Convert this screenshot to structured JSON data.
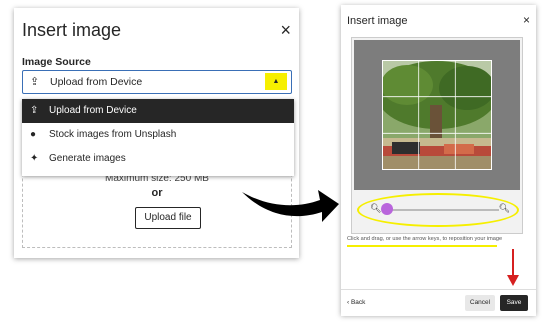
{
  "left_dialog": {
    "title": "Insert image",
    "close_icon": "×",
    "source_label": "Image Source",
    "selected": "Upload from Device",
    "menu_items": [
      {
        "icon": "upload-icon",
        "glyph": "⇪",
        "label": "Upload from Device"
      },
      {
        "icon": "globe-icon",
        "glyph": "●",
        "label": "Stock images from Unsplash"
      },
      {
        "icon": "sparkle-icon",
        "glyph": "✦",
        "label": "Generate images"
      }
    ],
    "max_size_text": "Maximum size: 250 MB",
    "or_text": "or",
    "upload_button": "Upload file"
  },
  "right_dialog": {
    "title": "Insert image",
    "close_icon": "×",
    "zoom_out_icon": "🔍︎",
    "zoom_in_icon": "🔍︎",
    "zoom_level": 0.0,
    "instructions": "Click and drag, or use the arrow keys, to reposition your image",
    "back_label": "‹ Back",
    "cancel_label": "Cancel",
    "save_label": "Save"
  },
  "colors": {
    "highlight": "#f6ef00",
    "accent_border": "#3a6fb6",
    "slider_thumb": "#b965dc",
    "arrow_red": "#d62020",
    "dark": "#262626"
  }
}
